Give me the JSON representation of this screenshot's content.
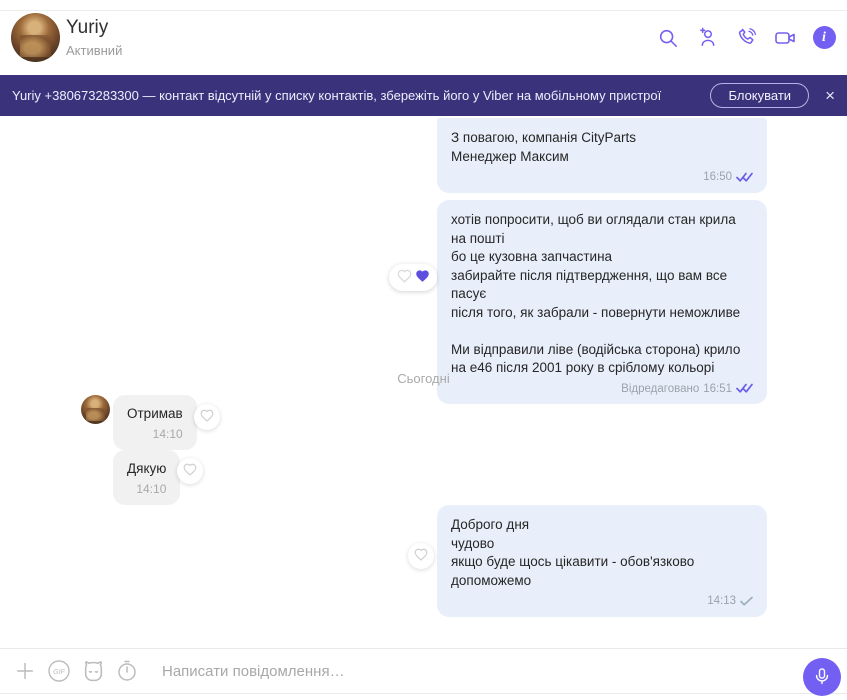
{
  "colors": {
    "accent": "#7360f2",
    "banner_bg": "#3b327c",
    "outgoing_bubble": "#e8effa",
    "incoming_bubble": "#f1f1f1",
    "read_check": "#6b5ce7"
  },
  "header": {
    "name": "Yuriy",
    "status": "Активний",
    "icons": [
      "search",
      "add-contact",
      "voice-call",
      "video-call",
      "info"
    ]
  },
  "banner": {
    "text": "Yuriy +380673283300 — контакт відсутній у списку контактів, збережіть його у Viber на мобільному пристрої",
    "block_button": "Блокувати",
    "close": "×"
  },
  "conversation": {
    "date_divider": "Сьогодні",
    "messages": [
      {
        "direction": "outgoing",
        "lines": [
          "З повагою, компанія CityParts",
          "Менеджер Максим"
        ],
        "time": "16:50",
        "status": "read"
      },
      {
        "direction": "outgoing",
        "lines": [
          "хотів попросити, щоб ви оглядали стан крила на пошті",
          "бо це кузовна запчастина",
          "забирайте після підтвердження, що вам все пасує",
          "після того, як забрали - повернути неможливе",
          "",
          " Ми відправили ліве (водійська сторона) крило на е46 після 2001 року в сріблому кольорі"
        ],
        "edited_label": "Відредаговано",
        "time": "16:51",
        "status": "read",
        "reaction": "heart"
      },
      {
        "direction": "incoming",
        "lines": [
          "Отримав"
        ],
        "time": "14:10"
      },
      {
        "direction": "incoming",
        "lines": [
          "Дякую"
        ],
        "time": "14:10"
      },
      {
        "direction": "outgoing",
        "lines": [
          "Доброго дня",
          "чудово",
          "якщо буде щось цікавити - обов'язково допоможемо"
        ],
        "time": "14:13",
        "status": "sent"
      }
    ]
  },
  "composer": {
    "placeholder": "Написати повідомлення…",
    "icons": [
      "attach",
      "gif",
      "sticker",
      "secret-timer",
      "microphone"
    ],
    "info_letter": "i"
  }
}
